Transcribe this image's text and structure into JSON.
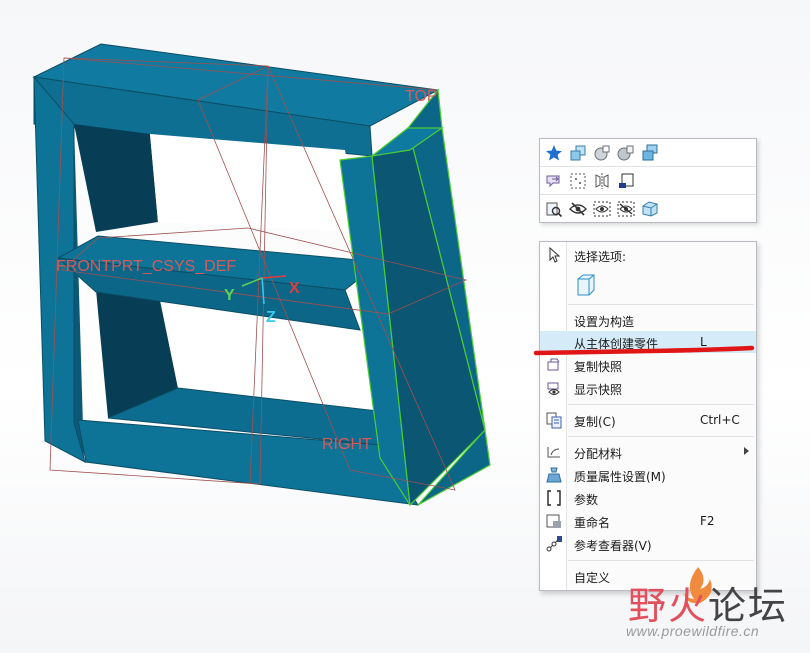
{
  "model_view": {
    "datum_labels": {
      "top": "TOP",
      "right": "RIGHT",
      "csys": "FRONTPRT_CSYS_DEF"
    },
    "axes": {
      "x": "X",
      "y": "Y",
      "z": "Z"
    },
    "colors": {
      "body_face": "#0e7497",
      "body_side": "#0b5c78",
      "body_dark": "#073e55",
      "highlight_edge": "#4ccc33",
      "datum_line": "#a05050"
    }
  },
  "mini_toolbar": {
    "rows": [
      [
        "star-icon",
        "box-copy-icon",
        "sphere-icon",
        "sphere-box-icon",
        "stack-boxes-icon"
      ],
      [
        "speech-arrow-icon",
        "grid-select-icon",
        "mirror-icon",
        "box-corner-icon"
      ],
      [
        "search-box-icon",
        "hide-eye-icon",
        "show-eye-icon",
        "hide-select-icon",
        "solid-box-icon"
      ]
    ]
  },
  "context_menu": {
    "header": "选择选项:",
    "items": [
      {
        "label": "设置为构造",
        "shortcut": ""
      },
      {
        "label": "从主体创建零件",
        "shortcut": "L",
        "highlighted": true
      },
      {
        "label": "复制快照",
        "shortcut": ""
      },
      {
        "label": "显示快照",
        "shortcut": ""
      },
      {
        "label": "复制(C)",
        "shortcut": "Ctrl+C"
      },
      {
        "label": "分配材料",
        "shortcut": "",
        "submenu": true
      },
      {
        "label": "质量属性设置(M)",
        "shortcut": ""
      },
      {
        "label": "参数",
        "shortcut": ""
      },
      {
        "label": "重命名",
        "shortcut": "F2"
      },
      {
        "label": "参考查看器(V)",
        "shortcut": ""
      },
      {
        "label": "自定义",
        "shortcut": ""
      }
    ],
    "accent_underline_color": "#e01515"
  },
  "watermark": {
    "title_a": "野火",
    "title_b": "论坛",
    "url": "www.proewildfire.cn"
  }
}
